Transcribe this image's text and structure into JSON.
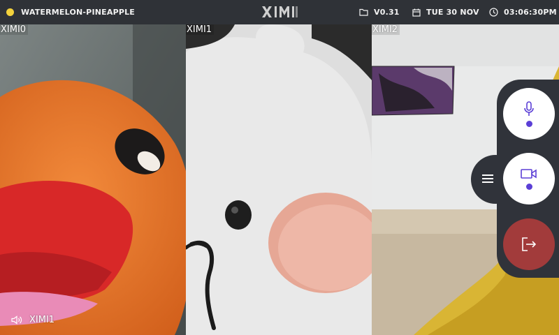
{
  "topbar": {
    "session_name": "WATERMELON-PINEAPPLE",
    "status_color": "#f3d23c",
    "version": "V0.31",
    "date": "TUE 30 NOV",
    "time": "03:06:30PM",
    "icons": [
      "folder-icon",
      "calendar-icon",
      "clock-icon"
    ]
  },
  "tiles": [
    {
      "label": "XIMI0",
      "speaker_label": "XIMI1"
    },
    {
      "label": "XIMI1"
    },
    {
      "label": "XIMI2"
    }
  ],
  "controls": {
    "icons": [
      "menu-icon",
      "microphone-icon",
      "camera-icon",
      "leave-icon"
    ],
    "accent_color": "#5b3fd6",
    "leave_color": "#a23b3b"
  }
}
